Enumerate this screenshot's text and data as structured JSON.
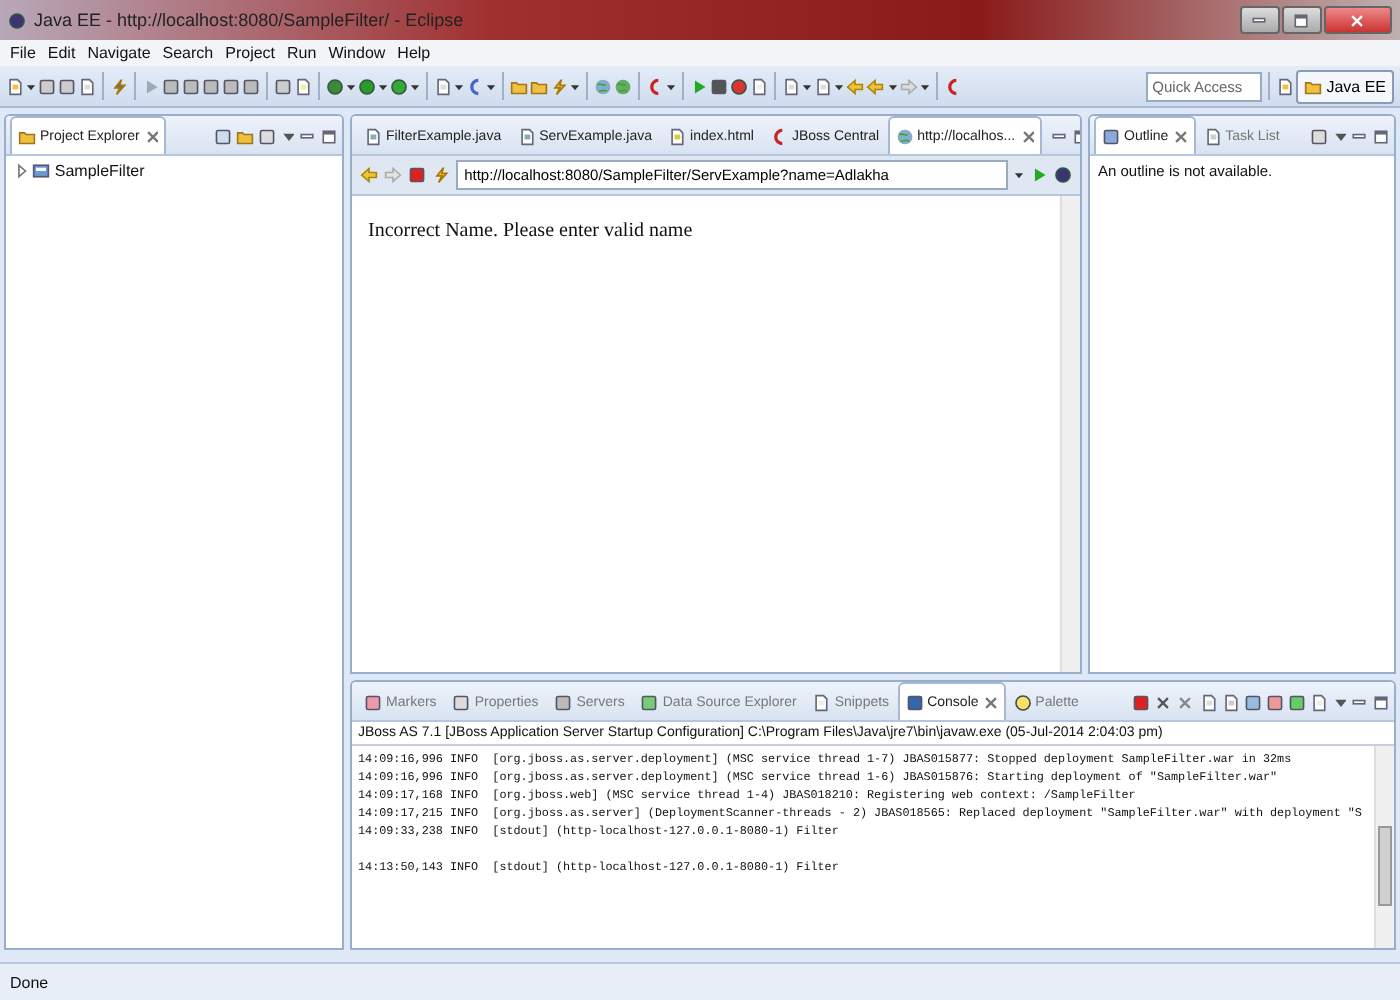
{
  "window": {
    "title": "Java EE - http://localhost:8080/SampleFilter/ - Eclipse"
  },
  "menu": [
    "File",
    "Edit",
    "Navigate",
    "Search",
    "Project",
    "Run",
    "Window",
    "Help"
  ],
  "toolbar": {
    "quick_access": {
      "placeholder": "Quick Access"
    },
    "perspectives": [
      {
        "label": "Java EE",
        "selected": true
      }
    ]
  },
  "project_explorer": {
    "tabs": [
      {
        "label": "Project Explorer",
        "selected": true
      }
    ],
    "tree": [
      {
        "label": "SampleFilter",
        "expanded": false
      }
    ]
  },
  "editor": {
    "tabs": [
      {
        "label": "FilterExample.java",
        "selected": false
      },
      {
        "label": "ServExample.java",
        "selected": false
      },
      {
        "label": "index.html",
        "selected": false
      },
      {
        "label": "JBoss Central",
        "selected": false
      },
      {
        "label": "http://localhos...",
        "selected": true
      }
    ],
    "browser": {
      "url": "http://localhost:8080/SampleFilter/ServExample?name=Adlakha"
    },
    "page_text": "Incorrect Name. Please enter valid name"
  },
  "side_panel": {
    "tabs": [
      {
        "label": "Outline",
        "selected": true
      },
      {
        "label": "Task List",
        "selected": false
      }
    ],
    "message": "An outline is not available."
  },
  "console": {
    "tabs": [
      {
        "label": "Markers",
        "selected": false
      },
      {
        "label": "Properties",
        "selected": false
      },
      {
        "label": "Servers",
        "selected": false
      },
      {
        "label": "Data Source Explorer",
        "selected": false
      },
      {
        "label": "Snippets",
        "selected": false
      },
      {
        "label": "Console",
        "selected": true
      },
      {
        "label": "Palette",
        "selected": false
      }
    ],
    "header": "JBoss AS 7.1 [JBoss Application Server Startup Configuration] C:\\Program Files\\Java\\jre7\\bin\\javaw.exe (05-Jul-2014 2:04:03 pm)",
    "blocks": [
      [
        "14:09:16,996 INFO  [org.jboss.as.server.deployment] (MSC service thread 1-7) JBAS015877: Stopped deployment SampleFilter.war in 32ms",
        "14:09:16,996 INFO  [org.jboss.as.server.deployment] (MSC service thread 1-6) JBAS015876: Starting deployment of \"SampleFilter.war\"",
        "14:09:17,168 INFO  [org.jboss.web] (MSC service thread 1-4) JBAS018210: Registering web context: /SampleFilter",
        "14:09:17,215 INFO  [org.jboss.as.server] (DeploymentScanner-threads - 2) JBAS018565: Replaced deployment \"SampleFilter.war\" with deployment \"S",
        "14:09:33,238 INFO  [stdout] (http-localhost-127.0.0.1-8080-1) Filter"
      ],
      [
        "14:13:50,143 INFO  [stdout] (http-localhost-127.0.0.1-8080-1) Filter"
      ]
    ]
  },
  "status_bar": "Done"
}
